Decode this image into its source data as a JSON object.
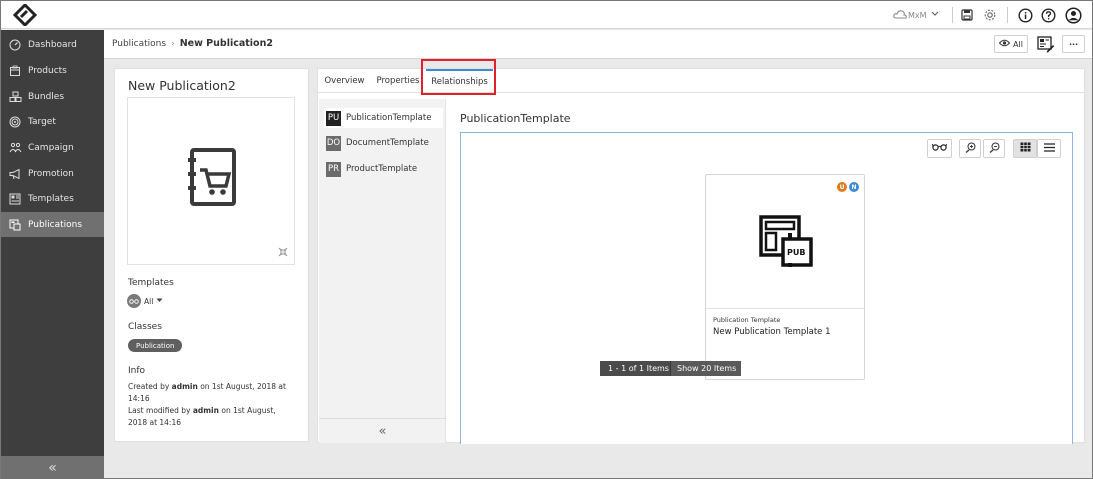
{
  "topbar": {
    "account_label": "MxM",
    "icons": [
      "cloud-icon",
      "save-icon",
      "gear-icon",
      "info-icon",
      "help-icon",
      "user-icon"
    ]
  },
  "sidebar": {
    "items": [
      {
        "label": "Dashboard",
        "icon": "dashboard-icon",
        "active": false
      },
      {
        "label": "Products",
        "icon": "products-icon",
        "active": false
      },
      {
        "label": "Bundles",
        "icon": "bundles-icon",
        "active": false
      },
      {
        "label": "Target",
        "icon": "target-icon",
        "active": false
      },
      {
        "label": "Campaign",
        "icon": "campaign-icon",
        "active": false
      },
      {
        "label": "Promotion",
        "icon": "promotion-icon",
        "active": false
      },
      {
        "label": "Templates",
        "icon": "templates-icon",
        "active": false
      },
      {
        "label": "Publications",
        "icon": "publications-icon",
        "active": true
      }
    ],
    "collapse_glyph": "«"
  },
  "breadcrumb": {
    "parent": "Publications",
    "separator": "›",
    "current": "New Publication2"
  },
  "header_actions": {
    "view_all_label": "All",
    "more_glyph": "···"
  },
  "detail": {
    "title": "New Publication2",
    "templates_label": "Templates",
    "templates_filter": "All",
    "classes_label": "Classes",
    "class_tag": "Publication",
    "info_label": "Info",
    "created_prefix": "Created by ",
    "created_user": "admin",
    "created_suffix": " on 1st August, 2018 at 14:16",
    "modified_prefix": "Last modified by ",
    "modified_user": "admin",
    "modified_suffix": " on 1st August,",
    "modified_line2": "2018 at 14:16"
  },
  "tabs": [
    {
      "label": "Overview",
      "active": false
    },
    {
      "label": "Properties",
      "active": false
    },
    {
      "label": "Relationships",
      "active": true
    }
  ],
  "relationships": [
    {
      "code": "PU",
      "label": "PublicationTemplate",
      "active": true,
      "color": "#222222"
    },
    {
      "code": "DO",
      "label": "DocumentTemplate",
      "active": false,
      "color": "#6b6b6b"
    },
    {
      "code": "PR",
      "label": "ProductTemplate",
      "active": false,
      "color": "#6b6b6b"
    }
  ],
  "rel_collapse_glyph": "«",
  "section_title": "PublicationTemplate",
  "card": {
    "badge_u": "U",
    "badge_n": "N",
    "badge_u_color": "#e07b1a",
    "badge_n_color": "#3f8bd6",
    "image_label": "PUB",
    "type": "Publication Template",
    "name": "New Publication Template 1"
  },
  "pager": {
    "range": "1 - 1 of 1 Items",
    "show": "Show 20 Items"
  },
  "colors": {
    "accent": "#3f8bd6",
    "highlight": "#e0212a",
    "sidebar_bg": "#3e3e3e",
    "sidebar_active": "#707070"
  }
}
